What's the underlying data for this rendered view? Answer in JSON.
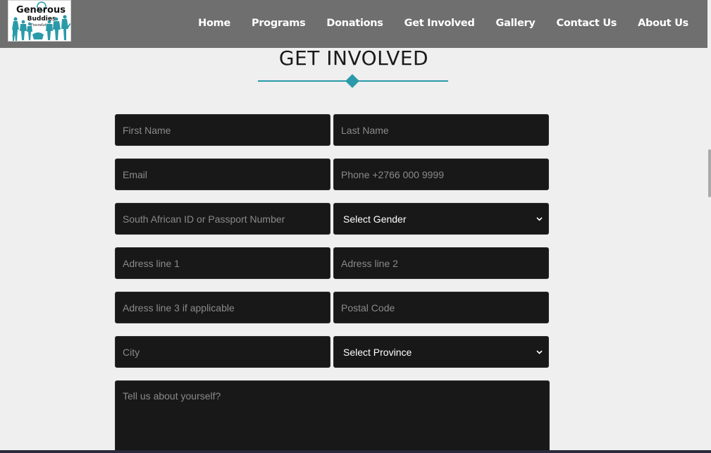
{
  "brand": {
    "logo_line1": "Generous",
    "logo_line2": "Buddies",
    "logo_line3": "Foundation"
  },
  "nav": {
    "items": [
      {
        "label": "Home"
      },
      {
        "label": "Programs"
      },
      {
        "label": "Donations"
      },
      {
        "label": "Get Involved"
      },
      {
        "label": "Gallery"
      },
      {
        "label": "Contact Us"
      },
      {
        "label": "About Us"
      }
    ]
  },
  "section": {
    "title": "GET INVOLVED"
  },
  "form": {
    "first_name": {
      "placeholder": "First Name",
      "value": ""
    },
    "last_name": {
      "placeholder": "Last Name",
      "value": ""
    },
    "email": {
      "placeholder": "Email",
      "value": ""
    },
    "phone": {
      "placeholder": "Phone +2766 000 9999",
      "value": ""
    },
    "id_number": {
      "placeholder": "South African ID or Passport Number",
      "value": ""
    },
    "gender": {
      "selected": "Select Gender"
    },
    "address1": {
      "placeholder": "Adress line 1",
      "value": ""
    },
    "address2": {
      "placeholder": "Adress line 2",
      "value": ""
    },
    "address3": {
      "placeholder": "Adress line 3 if applicable",
      "value": ""
    },
    "postal_code": {
      "placeholder": "Postal Code",
      "value": ""
    },
    "city": {
      "placeholder": "City",
      "value": ""
    },
    "province": {
      "selected": "Select Province"
    },
    "about": {
      "placeholder": "Tell us about yourself?",
      "value": ""
    }
  },
  "colors": {
    "navbar_bg": "#6f6f6f",
    "page_bg": "#efefef",
    "field_bg": "#181818",
    "accent": "#2a9aa8"
  }
}
